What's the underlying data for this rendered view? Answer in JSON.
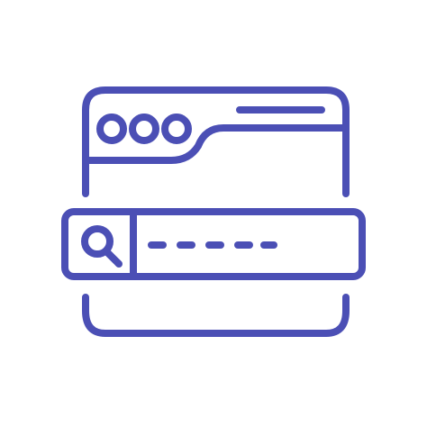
{
  "icon": {
    "name": "browser-search-icon",
    "stroke_color": "#4B4FB5",
    "background": "#FFFFFF"
  }
}
